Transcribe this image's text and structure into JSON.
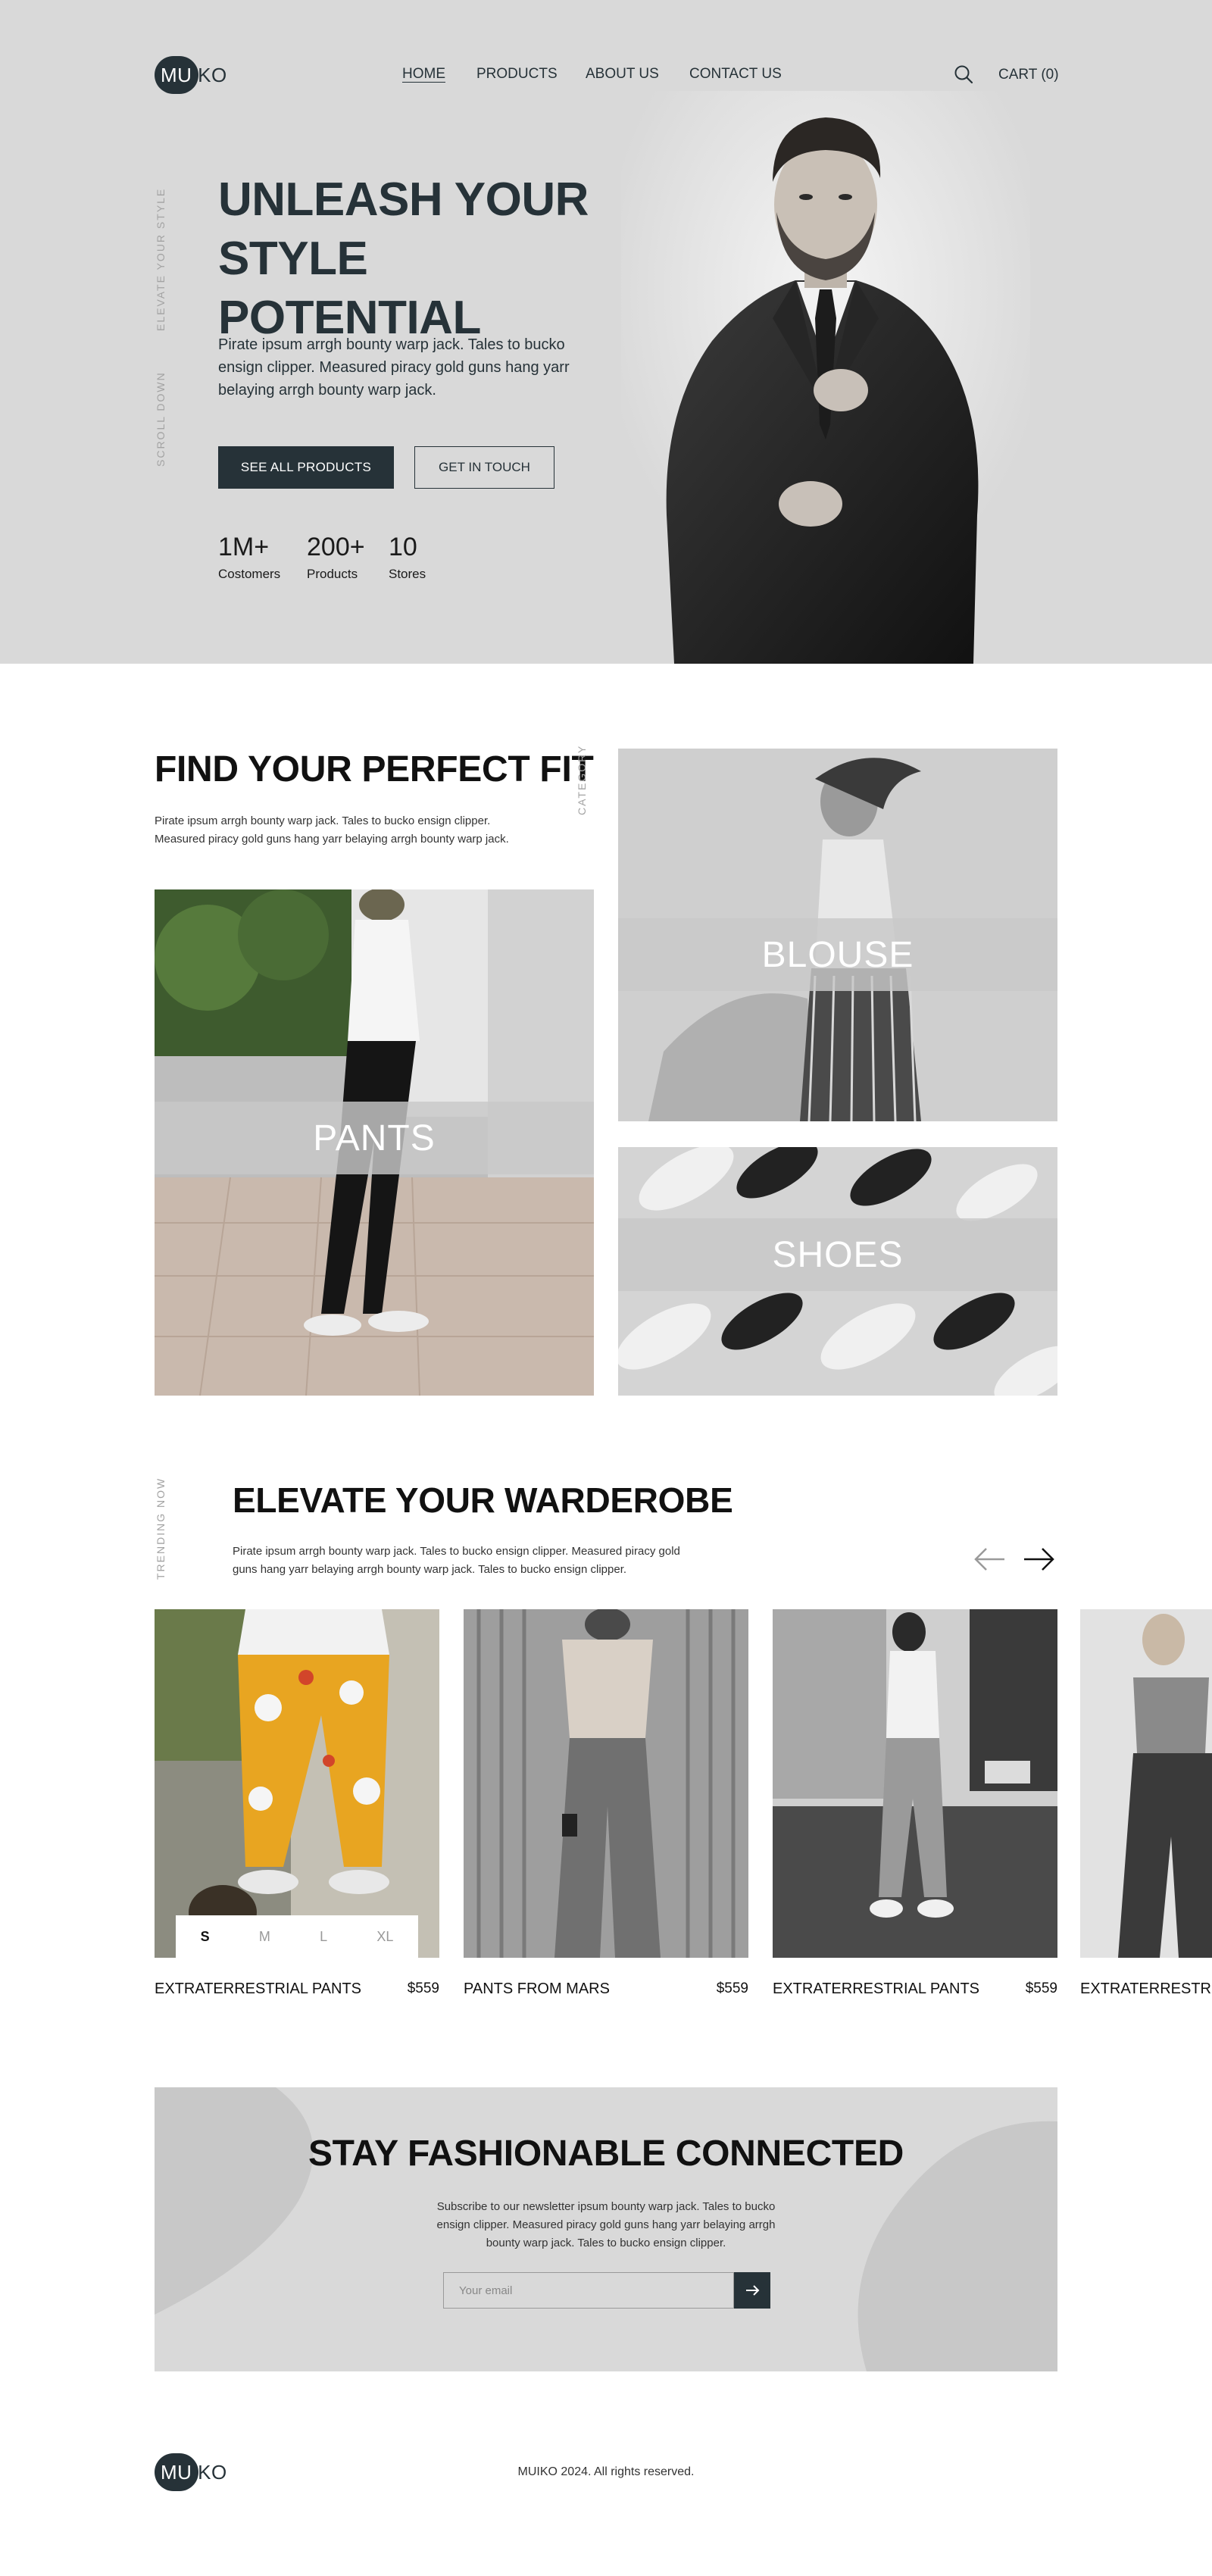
{
  "brand": {
    "logo_left": "MU",
    "logo_right": "IKO"
  },
  "nav": {
    "items": [
      "HOME",
      "PRODUCTS",
      "ABOUT US",
      "CONTACT US"
    ],
    "active": "HOME"
  },
  "header": {
    "cart_label": "CART (0)",
    "search_icon": "search-icon"
  },
  "hero": {
    "side_label_1": "ELEVATE YOUR STYLE",
    "side_label_2": "SCROLL DOWN",
    "title_line1": "UNLEASH YOUR",
    "title_line2": "STYLE POTENTIAL",
    "description": "Pirate ipsum arrgh bounty warp jack. Tales to bucko ensign clipper. Measured piracy gold guns hang yarr belaying arrgh bounty warp jack.",
    "primary_button": "SEE ALL PRODUCTS",
    "secondary_button": "GET IN TOUCH",
    "stats": [
      {
        "value": "1M+",
        "label": "Costomers"
      },
      {
        "value": "200+",
        "label": "Products"
      },
      {
        "value": "10",
        "label": "Stores"
      }
    ]
  },
  "categories": {
    "title": "FIND YOUR PERFECT FIT",
    "side_label": "CATEGORY",
    "description_line1": "Pirate ipsum arrgh bounty warp jack. Tales to bucko ensign clipper.",
    "description_line2": "Measured piracy gold guns hang yarr belaying arrgh bounty warp jack.",
    "items": [
      "PANTS",
      "BLOUSE",
      "SHOES"
    ]
  },
  "trending": {
    "side_label": "TRENDING NOW",
    "title": "ELEVATE YOUR WARDEROBE",
    "description_line1": "Pirate ipsum arrgh bounty warp jack. Tales to bucko ensign clipper. Measured piracy gold",
    "description_line2": "guns hang yarr belaying arrgh bounty warp jack. Tales to bucko ensign clipper.",
    "sizes": [
      "S",
      "M",
      "L",
      "XL"
    ],
    "selected_size": "S",
    "products": [
      {
        "name": "EXTRATERRESTRIAL PANTS",
        "price": "$559"
      },
      {
        "name": "PANTS FROM MARS",
        "price": "$559"
      },
      {
        "name": "EXTRATERRESTRIAL PANTS",
        "price": "$559"
      },
      {
        "name": "EXTRATERRESTRIAL PANTS",
        "price": ""
      }
    ]
  },
  "newsletter": {
    "title": "STAY FASHIONABLE CONNECTED",
    "description": "Subscribe to our newsletter ipsum bounty warp jack. Tales to bucko ensign clipper. Measured piracy gold guns hang yarr belaying arrgh bounty warp jack. Tales to bucko ensign clipper.",
    "email_placeholder": "Your email"
  },
  "footer": {
    "copyright": "MUIKO 2024. All rights reserved."
  },
  "colors": {
    "accent": "#263238",
    "hero_bg": "#d9d9d9",
    "product_yellow": "#e8a521"
  }
}
